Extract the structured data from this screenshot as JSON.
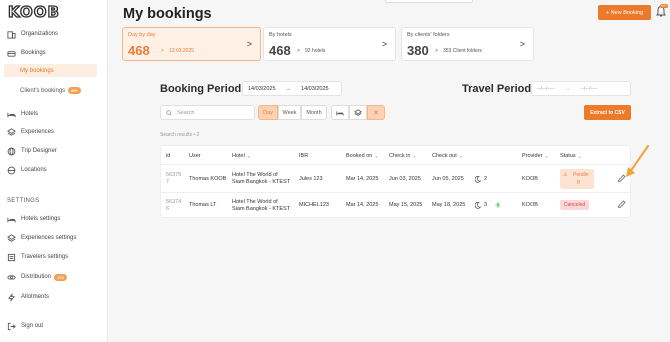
{
  "brand": "KOOB",
  "sidebar": {
    "items": [
      {
        "label": "Organizations",
        "icon": "building-icon"
      },
      {
        "label": "Bookings",
        "icon": "bookings-icon"
      }
    ],
    "sub_items": [
      {
        "label": "My bookings",
        "active": true
      },
      {
        "label": "Client's bookings",
        "badge": "99+"
      }
    ],
    "items2": [
      {
        "label": "Hotels",
        "icon": "bed-icon"
      },
      {
        "label": "Experiences",
        "icon": "layers-icon"
      },
      {
        "label": "Trip Designer",
        "icon": "globe-icon"
      },
      {
        "label": "Locations",
        "icon": "globe-icon"
      }
    ],
    "settings_label": "SETTINGS",
    "settings_items": [
      {
        "label": "Hotels settings",
        "icon": "bed-icon"
      },
      {
        "label": "Experiences settings",
        "icon": "layers-icon"
      },
      {
        "label": "Travelers settings",
        "icon": "list-icon"
      },
      {
        "label": "Distribution",
        "icon": "link-icon",
        "badge": "170"
      },
      {
        "label": "Allotments",
        "icon": "bolt-icon"
      }
    ],
    "signout": "Sign out"
  },
  "header": {
    "title": "My bookings",
    "new_booking": "+ New Booking",
    "bell_badge": "99+"
  },
  "cards": [
    {
      "title": "Day by day",
      "count": "468",
      "meta": "13.03.2025",
      "active": true
    },
    {
      "title": "By hotels",
      "count": "468",
      "meta": "92 hotels",
      "active": false
    },
    {
      "title": "By clients' folders",
      "count": "380",
      "meta": "353 Client folders",
      "active": false
    }
  ],
  "booking_period": {
    "title": "Booking Period",
    "from": "14/03/2025",
    "to": "14/03/2025"
  },
  "travel_period": {
    "title": "Travel Period",
    "from": "--/--/----",
    "to": "--/--/----"
  },
  "toolbar": {
    "search_placeholder": "Search",
    "day": "Day",
    "week": "Week",
    "month": "Month",
    "extract": "Extract to CSV"
  },
  "results_label": "Search results • 2",
  "table": {
    "columns": [
      "id",
      "User",
      "Hotel",
      "IBR",
      "Booked on",
      "Check in",
      "Check out",
      "Provider",
      "Status"
    ],
    "rows": [
      {
        "id_l1": "56375",
        "id_l2": "7",
        "user": "Thomas KOOB",
        "hotel_l1": "Hotel The World of",
        "hotel_l2": "Siam Bangkok - KTEST",
        "ibr": "Jules 123",
        "booked": "Mar 14, 2025",
        "checkin": "Jun 03, 2025",
        "checkout": "Jun 05, 2025",
        "nights": "2",
        "provider": "KOOB",
        "status_l1": "Pendin",
        "status_l2": "g"
      },
      {
        "id_l1": "56374",
        "id_l2": "6",
        "user": "Thomas LT",
        "hotel_l1": "Hotel The World of",
        "hotel_l2": "Siam Bangkok - KTEST",
        "ibr": "MICHEL123",
        "booked": "Mar 14, 2025",
        "checkin": "May 15, 2025",
        "checkout": "May 18, 2025",
        "nights": "3",
        "provider": "KOOB",
        "status": "Canceled"
      }
    ]
  },
  "colors": {
    "accent": "#ec7a2a",
    "accent_light": "#fef0e4",
    "cancel": "#d84848"
  }
}
